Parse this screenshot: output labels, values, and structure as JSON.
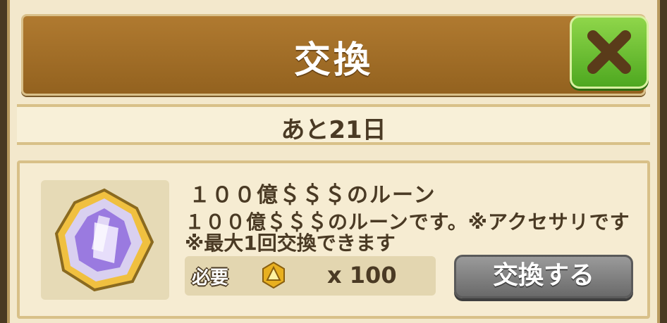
{
  "header": {
    "title": "交換"
  },
  "close_button": {
    "icon": "close-x-icon"
  },
  "timer": {
    "text": "あと21日"
  },
  "item": {
    "icon": "rune-crystal-icon",
    "name": "１００億＄＄＄のルーン",
    "description_line1": "１００億＄＄＄のルーンです。※アクセサリです",
    "description_line2": "※最大1回交換できます"
  },
  "requirement": {
    "label": "必要",
    "currency_icon": "medal-icon",
    "quantity": "x 100"
  },
  "exchange_button": {
    "label": "交換する"
  },
  "colors": {
    "header_brown": "#a06e28",
    "close_green": "#5db62a",
    "panel_cream": "#f3e8cc",
    "button_gray": "#808080"
  }
}
